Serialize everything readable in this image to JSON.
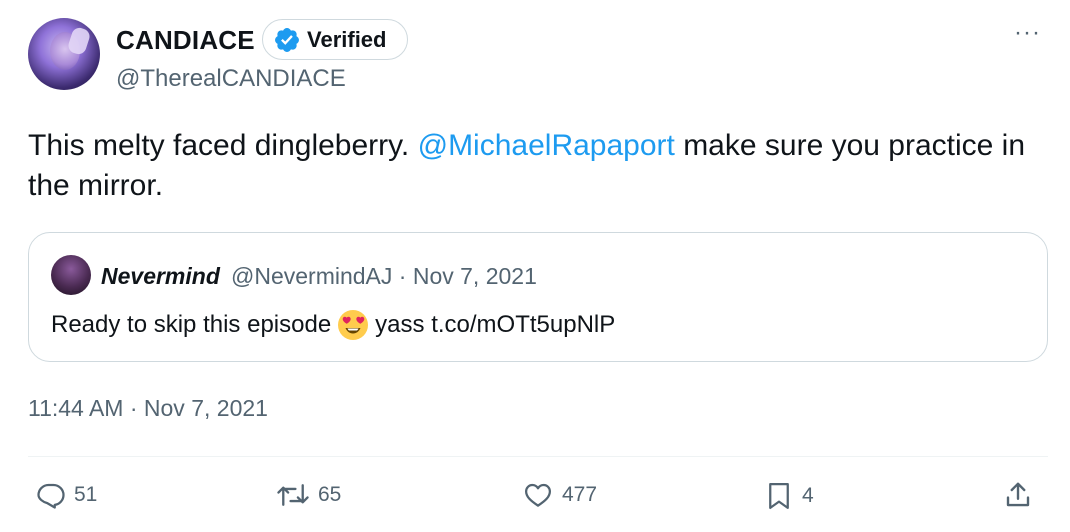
{
  "author": {
    "name": "CANDIACE",
    "verified_label": "Verified",
    "handle": "@TherealCANDIACE"
  },
  "tweet": {
    "text_before": "This melty faced dingleberry. ",
    "mention": "@MichaelRapaport",
    "text_after": " make sure you practice in the mirror."
  },
  "quoted": {
    "name": "Nevermind",
    "meta": "@NevermindAJ · Nov 7, 2021",
    "text_before": "Ready to skip this episode",
    "emoji": "heart-eyes-emoji",
    "text_after": "yass t.co/mOTt5upNlP"
  },
  "timestamp": "11:44 AM · Nov 7, 2021",
  "actions": {
    "replies": "51",
    "retweets": "65",
    "likes": "477",
    "bookmarks": "4"
  },
  "icons": {
    "more": "more-icon",
    "verified": "verified-badge-icon",
    "reply": "reply-icon",
    "retweet": "retweet-icon",
    "like": "heart-icon",
    "bookmark": "bookmark-icon",
    "share": "share-icon"
  },
  "colors": {
    "text": "#0f1419",
    "secondary": "#536471",
    "mention": "#1d9bf0",
    "verified": "#1d9bf0",
    "border": "#cfd9de"
  }
}
